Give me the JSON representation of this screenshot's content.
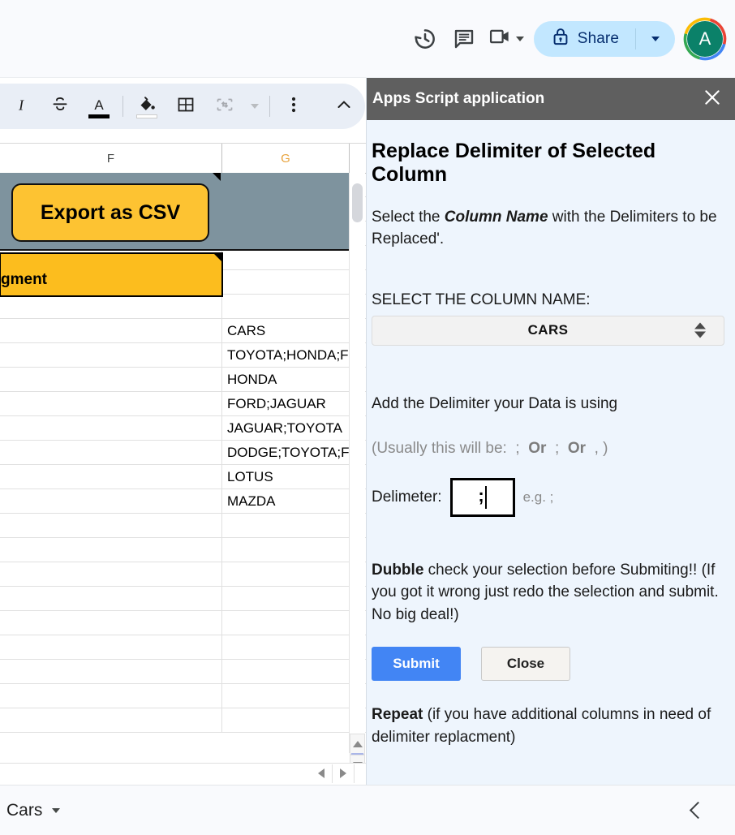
{
  "top_bar": {
    "history_icon": "history-clock-icon",
    "comment_icon": "comment-icon",
    "meet_icon": "video-camera-icon",
    "meet_caret_icon": "chevron-down-icon",
    "share_lock_icon": "lock-icon",
    "share_label": "Share",
    "share_caret_icon": "chevron-down-icon",
    "avatar_initial": "A"
  },
  "format_toolbar": {
    "italic_icon": "italic-icon",
    "strikethrough_icon": "strikethrough-icon",
    "text_color_icon": "text-color-icon",
    "text_color_swatch": "#000000",
    "fill_color_icon": "fill-color-icon",
    "fill_color_swatch": "#ffffff",
    "borders_icon": "borders-icon",
    "merge_icon": "merge-cells-icon",
    "merge_caret_icon": "chevron-down-icon",
    "more_icon": "more-vertical-icon",
    "collapse_icon": "chevron-up-icon"
  },
  "spreadsheet": {
    "columns": [
      {
        "label": "F",
        "selected": false
      },
      {
        "label": "G",
        "selected": true
      }
    ],
    "banner": {
      "background_color": "#7e939e",
      "button_label": "Export as CSV",
      "button_color": "#fdc332"
    },
    "selected_cell": {
      "text": "gment",
      "fill_color": "#fcbd1e"
    },
    "column_g_values": [
      "CARS",
      "TOYOTA;HONDA;F",
      "HONDA",
      "FORD;JAGUAR",
      "JAGUAR;TOYOTA",
      "DODGE;TOYOTA;F",
      "LOTUS",
      "MAZDA"
    ],
    "empty_row_count": 12,
    "scroll_up_icon": "triangle-up-icon",
    "scroll_down_icon": "triangle-down-icon",
    "scroll_left_icon": "triangle-left-icon",
    "scroll_right_icon": "triangle-right-icon"
  },
  "sheet_bar": {
    "tab_name": "Cars",
    "tab_caret_icon": "chevron-down-icon",
    "collapse_icon": "chevron-left-icon"
  },
  "sidebar": {
    "title": "Apps Script application",
    "close_icon": "close-icon",
    "heading": "Replace Delimiter of Selected Column",
    "intro_prefix": "Select the ",
    "intro_emphasis": "Column Name",
    "intro_suffix": " with the Delimiters to be Replaced'.",
    "select_label": "SELECT THE COLUMN NAME:",
    "select_value": "CARS",
    "select_arrows_icon": "select-updown-arrows-icon",
    "delimiter_heading": "Add the Delimiter your Data is using",
    "delimiter_hint_prefix": "(Usually this will be: ",
    "delimiter_hint_a": ";",
    "delimiter_hint_or1": "Or",
    "delimiter_hint_b": ";",
    "delimiter_hint_or2": "Or",
    "delimiter_hint_c": ",",
    "delimiter_hint_suffix": ")",
    "delimiter_label": "Delimeter:",
    "delimiter_value": ";",
    "delimiter_example": "e.g. ;",
    "warn_bold": "Dubble",
    "warn_rest": " check your selection before Submiting!! (If you got it wrong just redo the selection and submit. No big deal!)",
    "submit_label": "Submit",
    "close_label": "Close",
    "repeat_bold": "Repeat",
    "repeat_rest": " (if you have additional columns in need of delimiter replacment)",
    "accent_color": "#4285f4",
    "background_color": "#eef5fd",
    "header_color": "#5f5f5f"
  }
}
